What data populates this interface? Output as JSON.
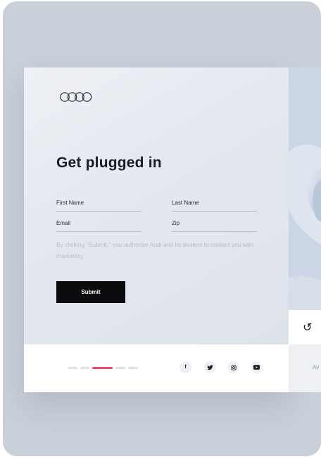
{
  "form": {
    "title": "Get plugged in",
    "first_name_placeholder": "First Name",
    "last_name_placeholder": "Last Name",
    "email_placeholder": "Email",
    "zip_placeholder": "Zip",
    "disclaimer": "By clicking \"Submit,\" you authorize Audi and its dealers to contact you with marketing",
    "submit_label": "Submit"
  },
  "footer": {
    "pager_dots": 5,
    "active_dot": 3,
    "social": [
      {
        "icon": "facebook-icon",
        "glyph": "f"
      },
      {
        "icon": "twitter-icon",
        "glyph": "t"
      },
      {
        "icon": "instagram-icon",
        "glyph": "◎"
      },
      {
        "icon": "youtube-icon",
        "glyph": "▶"
      }
    ]
  },
  "side_panel": {
    "footer_text": "Av",
    "rotate_icon": "↺"
  },
  "colors": {
    "accent": "#f0466a",
    "button": "#0b0b0d",
    "frame": "#c9d0da"
  }
}
